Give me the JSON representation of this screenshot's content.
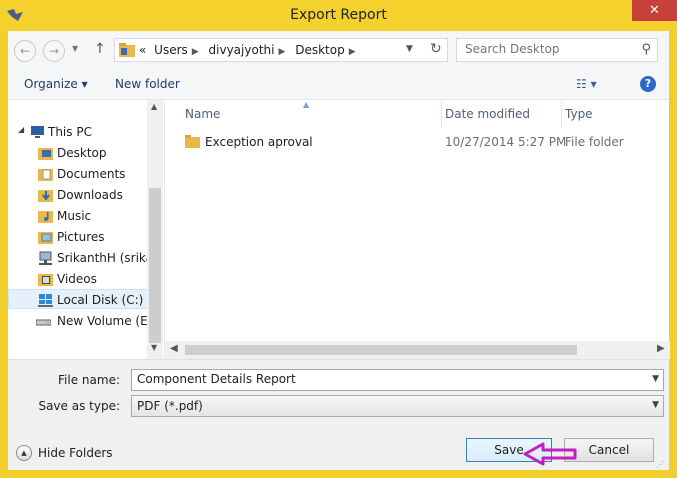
{
  "window": {
    "title": "Export Report",
    "close_label": "✕"
  },
  "address": {
    "overflow": "«",
    "crumbs": [
      "Users",
      "divyajyothi",
      "Desktop"
    ],
    "search_placeholder": "Search Desktop"
  },
  "toolbar": {
    "organize_label": "Organize ▾",
    "new_folder_label": "New folder",
    "view_label": "☷ ▾",
    "help_label": "?"
  },
  "navpane": {
    "items": [
      {
        "label": "This PC",
        "icon": "computer-icon"
      },
      {
        "label": "Desktop",
        "icon": "desktop-folder-icon"
      },
      {
        "label": "Documents",
        "icon": "documents-folder-icon"
      },
      {
        "label": "Downloads",
        "icon": "downloads-folder-icon"
      },
      {
        "label": "Music",
        "icon": "music-folder-icon"
      },
      {
        "label": "Pictures",
        "icon": "pictures-folder-icon"
      },
      {
        "label": "SrikanthH (srikan",
        "icon": "network-drive-icon"
      },
      {
        "label": "Videos",
        "icon": "videos-folder-icon"
      },
      {
        "label": "Local Disk (C:)",
        "icon": "windows-drive-icon",
        "selected": true
      },
      {
        "label": "New Volume (E:)",
        "icon": "drive-icon"
      }
    ]
  },
  "filelist": {
    "columns": [
      "Name",
      "Date modified",
      "Type"
    ],
    "rows": [
      {
        "name": "Exception aproval",
        "date": "10/27/2014 5:27 PM",
        "type": "File folder",
        "icon": "folder-icon"
      }
    ]
  },
  "bottom": {
    "filename_label": "File name:",
    "filename_value": "Component Details Report",
    "filetype_label": "Save as type:",
    "filetype_value": "PDF (*.pdf)",
    "hide_folders_label": "Hide Folders",
    "save_label": "Save",
    "cancel_label": "Cancel"
  },
  "colors": {
    "frame": "#f2ce2a",
    "close": "#c7403a",
    "annotation_arrow": "#c21fc2"
  }
}
